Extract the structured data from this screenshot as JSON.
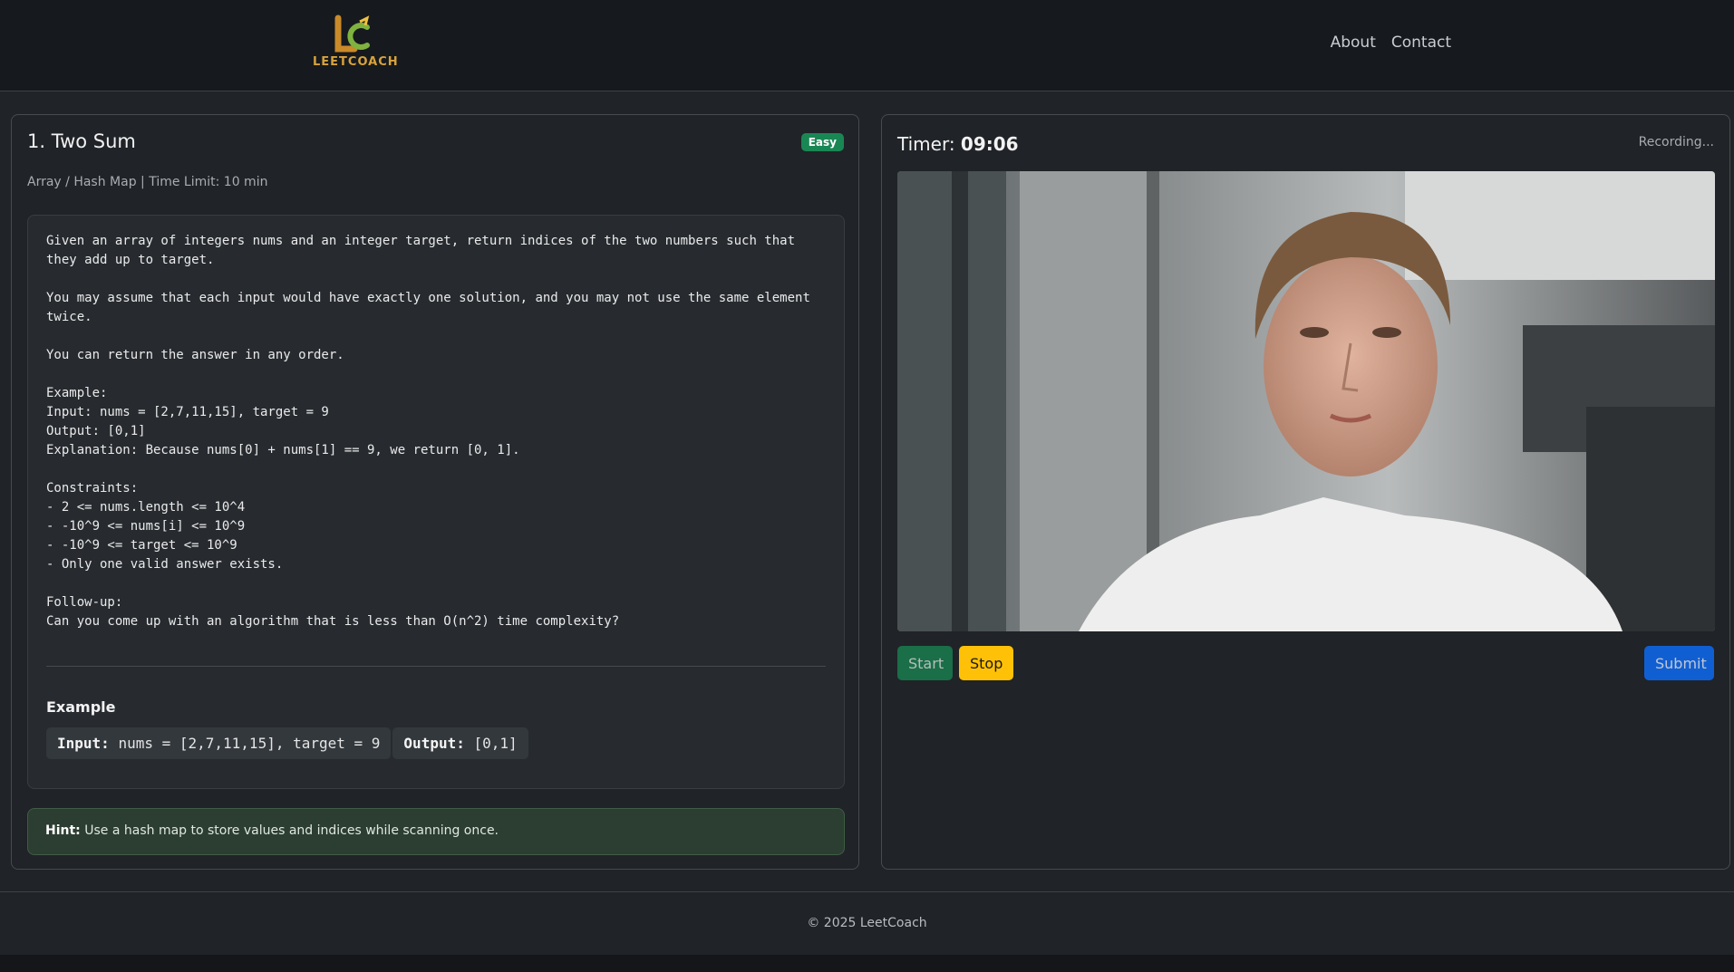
{
  "header": {
    "logo_text": "LEETCOACH",
    "nav": [
      {
        "label": "About"
      },
      {
        "label": "Contact"
      }
    ]
  },
  "problem": {
    "title": "1. Two Sum",
    "difficulty": "Easy",
    "meta": "Array / Hash Map | Time Limit: 10 min",
    "description": "Given an array of integers nums and an integer target, return indices of the two numbers such that they add up to target.\n\nYou may assume that each input would have exactly one solution, and you may not use the same element twice.\n\nYou can return the answer in any order.\n\nExample:\nInput: nums = [2,7,11,15], target = 9\nOutput: [0,1]\nExplanation: Because nums[0] + nums[1] == 9, we return [0, 1].\n\nConstraints:\n- 2 <= nums.length <= 10^4\n- -10^9 <= nums[i] <= 10^9\n- -10^9 <= target <= 10^9\n- Only one valid answer exists.\n\nFollow-up:\nCan you come up with an algorithm that is less than O(n^2) time complexity?",
    "example": {
      "heading": "Example",
      "input_label": "Input:",
      "input_value": "nums = [2,7,11,15], target = 9",
      "output_label": "Output:",
      "output_value": "[0,1]"
    },
    "hint": {
      "label": "Hint:",
      "text": "Use a hash map to store values and indices while scanning once."
    }
  },
  "recorder": {
    "timer_label": "Timer:",
    "timer_value": "09:06",
    "status": "Recording...",
    "buttons": {
      "start": "Start",
      "stop": "Stop",
      "submit": "Submit"
    }
  },
  "footer": {
    "text": "© 2025 LeetCoach"
  },
  "colors": {
    "easy_badge": "#198754",
    "start_button": "#198754",
    "stop_button": "#ffc107",
    "submit_button": "#0d6efd",
    "hint_background": "#2c3d31"
  }
}
